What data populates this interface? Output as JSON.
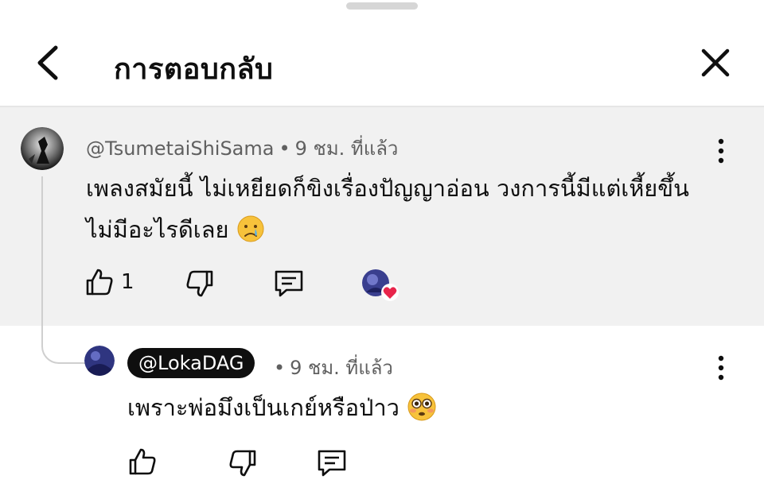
{
  "header": {
    "title": "การตอบกลับ",
    "back_icon": "chevron-left-icon",
    "close_icon": "close-icon"
  },
  "parent_comment": {
    "author": "@TsumetaiShiSama",
    "separator": "•",
    "time": "9 ชม. ที่แล้ว",
    "text_line1": "เพลงสมัยนี้ ไม่เหยียดก็ขิงเรื่องปัญญาอ่อน วงการนี้มีแต่เหี้ยขึ้น",
    "text_line2": "ไม่มีอะไรดีเลย",
    "emoji": "crying-face",
    "like_count": "1",
    "creator_heart": "heart-icon"
  },
  "reply": {
    "author": "@LokaDAG",
    "separator": "•",
    "time": "9 ชม. ที่แล้ว",
    "text": "เพราะพ่อมึงเป็นเกย์หรือป่าว",
    "emoji": "flushed-face"
  },
  "colors": {
    "background": "#ffffff",
    "highlight": "#f1f1f1",
    "text": "#0f0f0f",
    "meta": "#606060",
    "heart": "#e8254b",
    "chip": "#0f0f0f"
  }
}
